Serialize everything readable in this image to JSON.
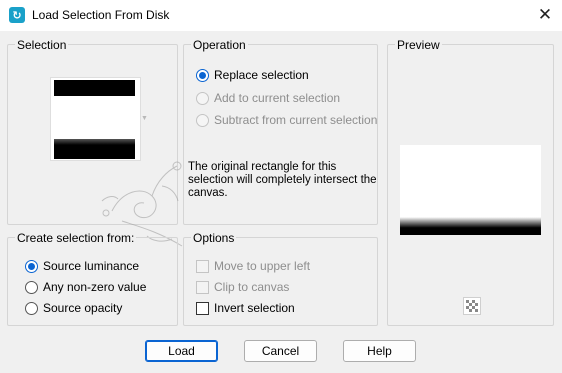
{
  "window": {
    "title": "Load Selection From Disk",
    "close_glyph": "✕"
  },
  "selection_group": {
    "title": "Selection"
  },
  "operation_group": {
    "title": "Operation",
    "options": [
      {
        "label": "Replace selection",
        "checked": true,
        "enabled": true
      },
      {
        "label": "Add to current selection",
        "checked": false,
        "enabled": false
      },
      {
        "label": "Subtract from current selection",
        "checked": false,
        "enabled": false
      }
    ],
    "info": "The original rectangle for this selection will completely intersect the canvas."
  },
  "preview_group": {
    "title": "Preview"
  },
  "create_group": {
    "title": "Create selection from:",
    "options": [
      {
        "label": "Source luminance",
        "checked": true
      },
      {
        "label": "Any non-zero value",
        "checked": false
      },
      {
        "label": "Source opacity",
        "checked": false
      }
    ]
  },
  "options_group": {
    "title": "Options",
    "checks": [
      {
        "label": "Move to upper left",
        "checked": false,
        "enabled": false
      },
      {
        "label": "Clip to canvas",
        "checked": false,
        "enabled": false
      },
      {
        "label": "Invert selection",
        "checked": false,
        "enabled": true
      }
    ]
  },
  "buttons": {
    "load": "Load",
    "cancel": "Cancel",
    "help": "Help"
  },
  "colors": {
    "accent": "#0a64d2",
    "app_icon": "#1aa1c9"
  }
}
